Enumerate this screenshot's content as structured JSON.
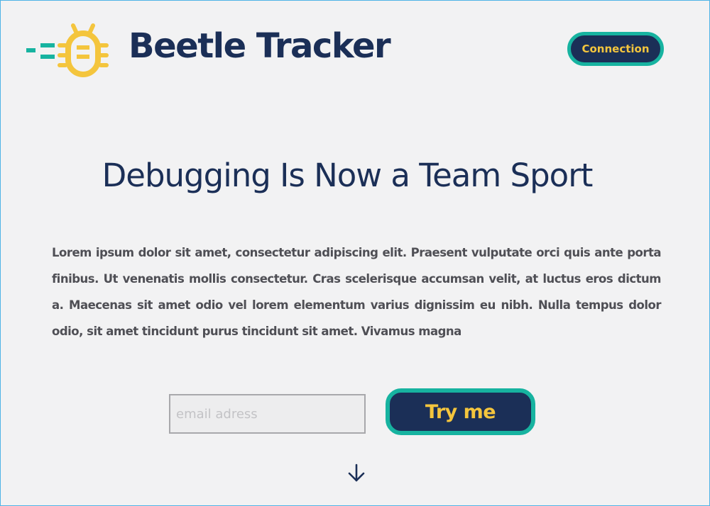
{
  "header": {
    "brand_name": "Beetle Tracker",
    "logo_icon": "beetle-logo-icon",
    "connection_label": "Connection"
  },
  "hero": {
    "title": "Debugging Is Now a Team Sport",
    "body": "Lorem ipsum dolor sit amet, consectetur adipiscing elit. Praesent vulputate orci quis ante porta finibus. Ut venenatis mollis consectetur. Cras scelerisque accumsan velit, at luctus eros dictum a. Maecenas sit amet odio vel lorem elementum varius dignissim eu nibh. Nulla tempus dolor odio, sit amet tincidunt purus tincidunt sit amet. Vivamus magna"
  },
  "signup": {
    "email_placeholder": "email adress",
    "email_value": "",
    "cta_label": "Try me"
  },
  "scroll_icon": "arrow-down-icon",
  "colors": {
    "background": "#f2f2f3",
    "navy": "#1b2f57",
    "teal": "#17b3a0",
    "yellow": "#f4c53d",
    "body_text": "#4f4f55"
  }
}
